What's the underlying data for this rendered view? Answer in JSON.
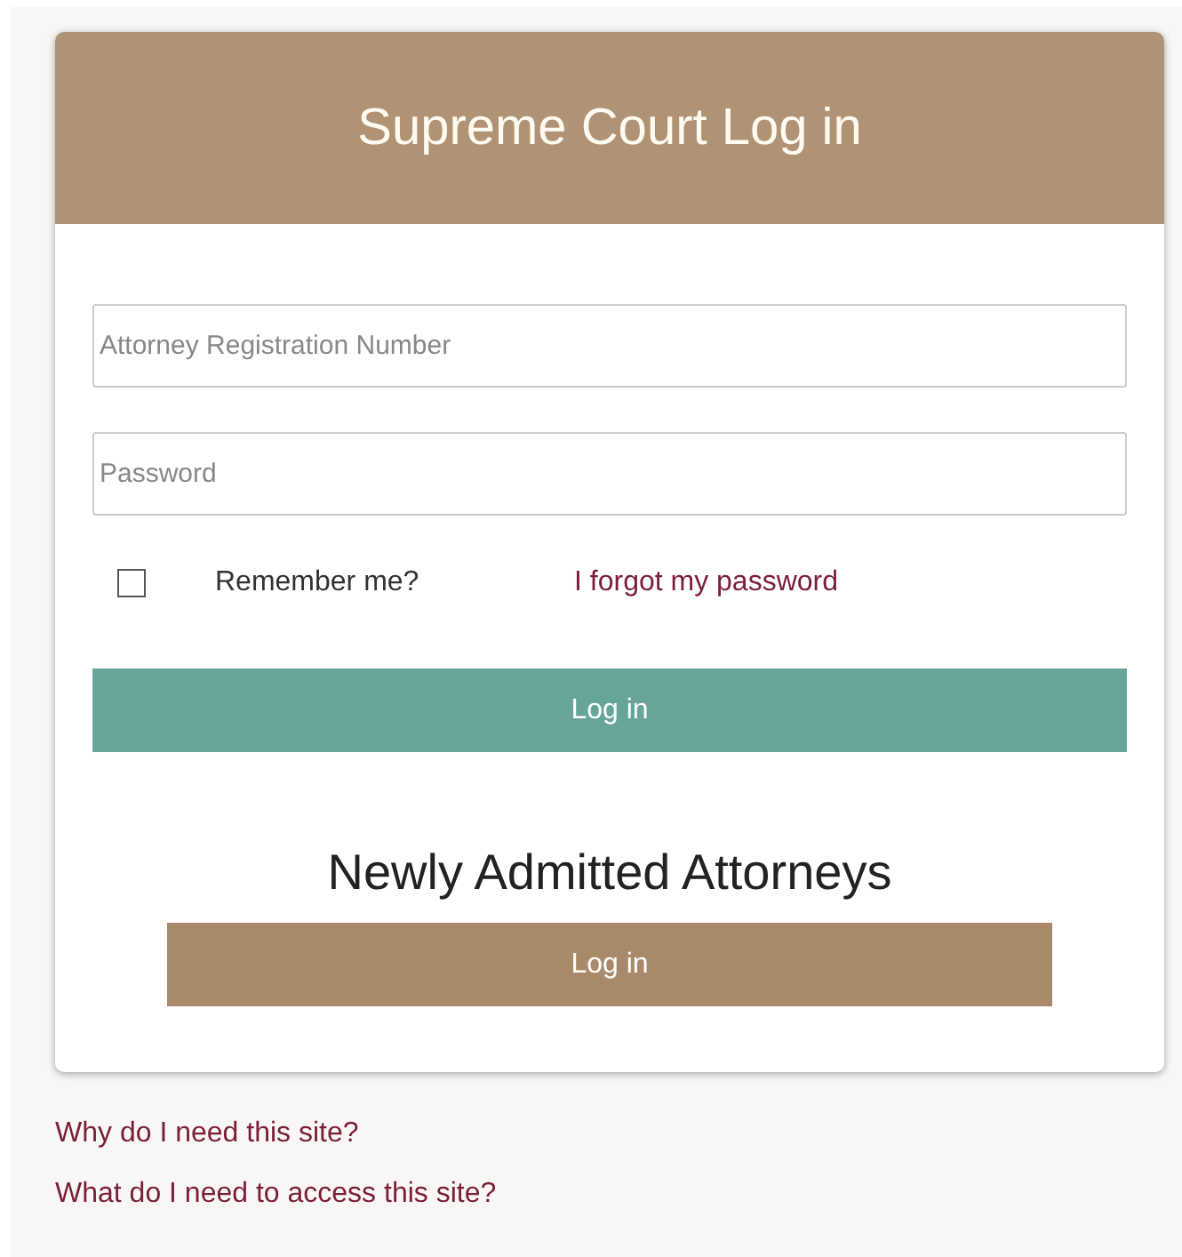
{
  "card": {
    "title": "Supreme Court Log in"
  },
  "fields": [
    {
      "placeholder": "Attorney Registration Number"
    },
    {
      "placeholder": "Password"
    }
  ],
  "remember": {
    "label": "Remember me?",
    "checked": false
  },
  "forgot_link": "I forgot my password",
  "login_button": "Log in",
  "newly_admitted": {
    "heading": "Newly Admitted Attorneys",
    "button": "Log in"
  },
  "links": [
    "Why do I need this site?",
    "What do I need to access this site?"
  ]
}
